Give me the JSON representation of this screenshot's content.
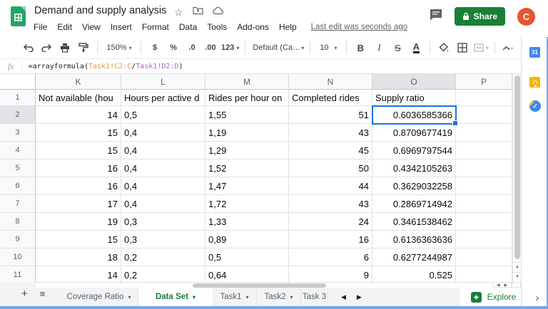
{
  "titlebar": {
    "title": "Demand and supply analysis",
    "last_edit": "Last edit was seconds ago",
    "share_label": "Share",
    "avatar_initial": "C"
  },
  "menus": [
    "File",
    "Edit",
    "View",
    "Insert",
    "Format",
    "Data",
    "Tools",
    "Add-ons",
    "Help"
  ],
  "toolbar": {
    "zoom": "150%",
    "currency": "$",
    "percent": "%",
    "decrease_decimal": ".0",
    "increase_decimal": ".00",
    "more_formats": "123",
    "font_name": "Default (Ca…",
    "font_size": "10",
    "bold": "B",
    "italic": "I",
    "strikethrough": "S",
    "text_color": "A",
    "more": "⋯"
  },
  "formula_bar": {
    "fx": "fx",
    "prefix": "=arrayformula(",
    "range1": "Task1!C2:C",
    "operator": "/",
    "range2": "Task1!D2:D",
    "suffix": ")"
  },
  "sheet": {
    "visible_columns": [
      "K",
      "L",
      "M",
      "N",
      "O",
      "P"
    ],
    "selected_column": "O",
    "selected_row": "2",
    "selected_cell": "O2",
    "header_row": {
      "number": "1",
      "cells": [
        "Not available (hou",
        "Hours per active d",
        "Rides per hour on",
        "Completed rides",
        "Supply ratio",
        ""
      ]
    },
    "rows": [
      {
        "number": "2",
        "K": "14",
        "L": "0,5",
        "M": "1,55",
        "N": "51",
        "O": "0.6036585366",
        "P": ""
      },
      {
        "number": "3",
        "K": "15",
        "L": "0,4",
        "M": "1,19",
        "N": "43",
        "O": "0.8709677419",
        "P": ""
      },
      {
        "number": "4",
        "K": "15",
        "L": "0,4",
        "M": "1,29",
        "N": "45",
        "O": "0.6969797544",
        "P": ""
      },
      {
        "number": "5",
        "K": "16",
        "L": "0,4",
        "M": "1,52",
        "N": "50",
        "O": "0.4342105263",
        "P": ""
      },
      {
        "number": "6",
        "K": "16",
        "L": "0,4",
        "M": "1,47",
        "N": "44",
        "O": "0.3629032258",
        "P": ""
      },
      {
        "number": "7",
        "K": "17",
        "L": "0,4",
        "M": "1,72",
        "N": "43",
        "O": "0.2869714942",
        "P": ""
      },
      {
        "number": "8",
        "K": "19",
        "L": "0,3",
        "M": "1,33",
        "N": "24",
        "O": "0.3461538462",
        "P": ""
      },
      {
        "number": "9",
        "K": "15",
        "L": "0,3",
        "M": "0,89",
        "N": "16",
        "O": "0.6136363636",
        "P": ""
      },
      {
        "number": "10",
        "K": "18",
        "L": "0,2",
        "M": "0,5",
        "N": "6",
        "O": "0.6277244987",
        "P": ""
      },
      {
        "number": "11",
        "K": "14",
        "L": "0,2",
        "M": "0,64",
        "N": "9",
        "O": "0.525",
        "P": ""
      }
    ]
  },
  "footer": {
    "tabs": [
      {
        "label": "Coverage Ratio",
        "active": false,
        "arrow": true
      },
      {
        "label": "Data Set",
        "active": true,
        "arrow": true
      },
      {
        "label": "Task1",
        "active": false,
        "arrow": true
      },
      {
        "label": "Task2",
        "active": false,
        "arrow": true
      },
      {
        "label": "Task 3",
        "active": false,
        "arrow": false
      }
    ],
    "explore_label": "Explore"
  },
  "side_panel": {
    "calendar_label": "31"
  },
  "colors": {
    "accent_blue": "#1a73e8",
    "share_green": "#188038",
    "active_tab_green": "#188038",
    "logo_green": "#23a566",
    "avatar_orange": "#e8542e",
    "formula_range1": "#e8963f",
    "formula_range2": "#9a6fc9"
  }
}
